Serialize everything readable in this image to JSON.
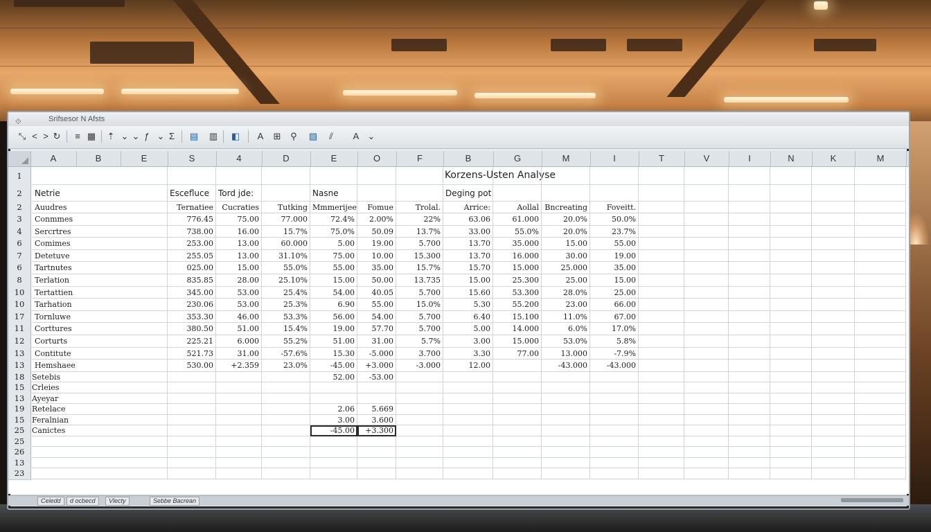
{
  "window": {
    "title": "Srifsesor N Afsts"
  },
  "toolbar": {
    "buttons": [
      {
        "name": "pointer-icon",
        "glyph": "⤡"
      },
      {
        "name": "back-icon",
        "glyph": "<"
      },
      {
        "name": "forward-icon",
        "glyph": ">"
      },
      {
        "name": "redo-icon",
        "glyph": "↻"
      },
      {
        "name": "align-icon",
        "glyph": "≡"
      },
      {
        "name": "table-icon",
        "glyph": "▦"
      },
      {
        "name": "sort-up-icon",
        "glyph": "⇡"
      },
      {
        "name": "dropdown1-icon",
        "glyph": "⌄"
      },
      {
        "name": "filter-icon",
        "glyph": "⌄"
      },
      {
        "name": "function-icon",
        "glyph": "ƒ"
      },
      {
        "name": "sort-icon",
        "glyph": "⌄"
      },
      {
        "name": "sum-icon",
        "glyph": "Σ"
      },
      {
        "name": "insert-chart-icon",
        "glyph": "▤"
      },
      {
        "name": "grid-icon",
        "glyph": "▥"
      },
      {
        "name": "python-icon",
        "glyph": "◧"
      },
      {
        "name": "font-icon",
        "glyph": "A"
      },
      {
        "name": "image-icon",
        "glyph": "⊞"
      },
      {
        "name": "find-icon",
        "glyph": "⚲"
      },
      {
        "name": "chart-icon",
        "glyph": "▧"
      },
      {
        "name": "pivot-icon",
        "glyph": "⫽"
      },
      {
        "name": "text-color-icon",
        "glyph": "A"
      },
      {
        "name": "more-icon",
        "glyph": "⌄"
      }
    ]
  },
  "columns": [
    "A",
    "B",
    "E",
    "S",
    "4",
    "D",
    "E",
    "O",
    "F",
    "B",
    "G",
    "M",
    "I",
    "T",
    "V",
    "I",
    "N",
    "K",
    "M"
  ],
  "chart_title": "Korzens-Usten Analyse",
  "headers_row1": {
    "c0": "Netrie",
    "c3": "Escefluce",
    "c4": "Tord jde:",
    "c6": "Nasne",
    "c9": "Deging pot"
  },
  "headers_row2": {
    "c0": "Auudres",
    "c3": "Ternatiee",
    "c4": "Cucraties",
    "c5": "Tutking",
    "c6": "Mmmerijee",
    "c7": "Fomue",
    "c8": "Trolal.",
    "c9": "Arrice:",
    "c10": "Aollal",
    "c11": "Bncreating",
    "c12": "Foveitt."
  },
  "rows": [
    {
      "num": "3",
      "label": "Conmmes",
      "v": [
        "776.45",
        "75.00",
        "77.000",
        "72.4%",
        "2.00%",
        "22%",
        "63.06",
        "61.000",
        "20.0%",
        "50.0%"
      ]
    },
    {
      "num": "4",
      "label": "Sercrtres",
      "v": [
        "738.00",
        "16.00",
        "15.7%",
        "75.0%",
        "50.09",
        "13.7%",
        "33.00",
        "55.0%",
        "20.0%",
        "23.7%"
      ]
    },
    {
      "num": "6",
      "label": "Comimes",
      "v": [
        "253.00",
        "13.00",
        "60.000",
        "5.00",
        "19.00",
        "5.700",
        "13.70",
        "35.000",
        "15.00",
        "55.00"
      ]
    },
    {
      "num": "7",
      "label": "Detetuve",
      "v": [
        "255.05",
        "13.00",
        "31.10%",
        "75.00",
        "10.00",
        "15.300",
        "13.70",
        "16.000",
        "30.00",
        "19.00"
      ]
    },
    {
      "num": "6",
      "label": "Tartnutes",
      "v": [
        "025.00",
        "15.00",
        "55.0%",
        "55.00",
        "35.00",
        "15.7%",
        "15.70",
        "15.000",
        "25.000",
        "35.00"
      ]
    },
    {
      "num": "8",
      "label": "Terlation",
      "v": [
        "835.85",
        "28.00",
        "25.10%",
        "15.00",
        "50.00",
        "13.735",
        "15.00",
        "25.300",
        "25.00",
        "15.00"
      ]
    },
    {
      "num": "10",
      "label": "Tertattien",
      "v": [
        "345.00",
        "53.00",
        "25.4%",
        "54.00",
        "40.05",
        "5.700",
        "15.60",
        "53.300",
        "28.0%",
        "25.00"
      ]
    },
    {
      "num": "10",
      "label": "Tarhation",
      "v": [
        "230.06",
        "53.00",
        "25.3%",
        "6.90",
        "55.00",
        "15.0%",
        "5.30",
        "55.200",
        "23.00",
        "66.00"
      ]
    },
    {
      "num": "17",
      "label": "Tornluwe",
      "v": [
        "353.30",
        "46.00",
        "53.3%",
        "56.00",
        "54.00",
        "5.700",
        "6.40",
        "15.100",
        "11.0%",
        "67.00"
      ]
    },
    {
      "num": "11",
      "label": "Corttures",
      "v": [
        "380.50",
        "51.00",
        "15.4%",
        "19.00",
        "57.70",
        "5.700",
        "5.00",
        "14.000",
        "6.0%",
        "17.0%"
      ]
    },
    {
      "num": "12",
      "label": "Corturts",
      "v": [
        "225.21",
        "6.000",
        "55.2%",
        "51.00",
        "31.00",
        "5.7%",
        "3.00",
        "15.000",
        "53.0%",
        "5.8%"
      ]
    },
    {
      "num": "13",
      "label": "Contitute",
      "v": [
        "521.73",
        "31.00",
        "-57.6%",
        "15.30",
        "-5.000",
        "3.700",
        "3.30",
        "77.00",
        "13.000",
        "-7.9%"
      ]
    },
    {
      "num": "13",
      "label": "Hemshaee",
      "v": [
        "530.00",
        "+2.359",
        "23.0%",
        "-45.00",
        "+3.000",
        "-3.000",
        "12.00",
        "",
        "-43.000",
        "-43.000"
      ]
    }
  ],
  "lower_rows": [
    {
      "num": "18",
      "label": "Setebis",
      "e": "52.00",
      "o": "-53.00"
    },
    {
      "num": "15",
      "label": "Crleies",
      "e": "",
      "o": ""
    },
    {
      "num": "13",
      "label": "Ayeyar",
      "e": "",
      "o": ""
    },
    {
      "num": "19",
      "label": "Retelace",
      "e": "2.06",
      "o": "5.669"
    },
    {
      "num": "15",
      "label": "Feralnian",
      "e": "3.00",
      "o": "3.600"
    },
    {
      "num": "25",
      "label": "Canictes",
      "e": "-45.00",
      "o": "+3.300"
    },
    {
      "num": "25",
      "label": "",
      "e": "",
      "o": ""
    },
    {
      "num": "26",
      "label": "",
      "e": "",
      "o": ""
    },
    {
      "num": "13",
      "label": "",
      "e": "",
      "o": ""
    },
    {
      "num": "23",
      "label": "",
      "e": "",
      "o": ""
    }
  ],
  "tabs": [
    "Celedd",
    "d ocbecd",
    "Vlecty",
    "Sebbe Bacrean"
  ]
}
